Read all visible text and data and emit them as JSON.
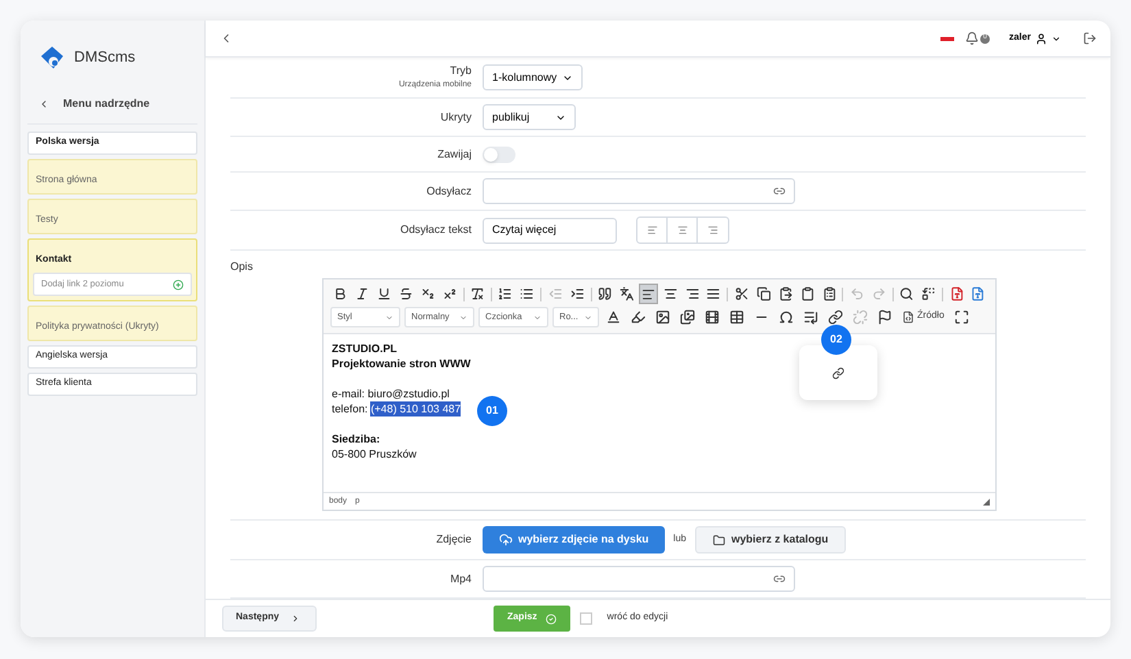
{
  "brand": {
    "name": "DMScms"
  },
  "sidebar": {
    "back_label": "Menu nadrzędne",
    "items": [
      {
        "label": "Polska wersja",
        "kind": "section"
      },
      {
        "label": "Strona główna",
        "kind": "page",
        "expanded": false
      },
      {
        "label": "Testy",
        "kind": "page",
        "expanded": false
      },
      {
        "label": "Kontakt",
        "kind": "page",
        "expanded": true,
        "add_placeholder": "Dodaj link 2 poziomu"
      },
      {
        "label": "Polityka prywatności (Ukryty)",
        "kind": "page",
        "expanded": false
      },
      {
        "label": "Angielska wersja",
        "kind": "section"
      },
      {
        "label": "Strefa klienta",
        "kind": "section"
      }
    ]
  },
  "header": {
    "notifications": "0",
    "user": "zaler"
  },
  "form_top": [
    {
      "label": "Tryb",
      "sublabel": "Urządzenia mobilne",
      "kind": "select",
      "value": "1-kolumnowy"
    },
    {
      "label": "Ukryty",
      "kind": "select",
      "value": "publikuj"
    },
    {
      "label": "Zawijaj",
      "kind": "toggle",
      "on": false
    },
    {
      "label": "Odsyłacz",
      "kind": "link_input"
    },
    {
      "label": "Odsyłacz tekst",
      "kind": "text_align",
      "value": "Czytaj więcej"
    }
  ],
  "editor": {
    "label": "Opis",
    "dropdowns": [
      "Styl",
      "Normalny",
      "Czcionka",
      "Ro..."
    ],
    "source_label": "Źródło",
    "align_left_active": true,
    "content": [
      {
        "kind": "bold",
        "text": "ZSTUDIO.PL"
      },
      {
        "kind": "bold",
        "text": "Projektowanie stron WWW"
      },
      {
        "kind": "blank"
      },
      {
        "kind": "text",
        "text": "e-mail: biuro@zstudio.pl"
      },
      {
        "kind": "highlight",
        "text": "telefon: ",
        "highlight": "(+48) 510 103 487"
      },
      {
        "kind": "blank"
      },
      {
        "kind": "bold",
        "text": "Siedziba:"
      },
      {
        "kind": "text",
        "text": "05-800 Pruszków"
      }
    ],
    "path": [
      "body",
      "p"
    ]
  },
  "callouts": [
    {
      "text": "01"
    },
    {
      "text": "02"
    }
  ],
  "form_bottom": [
    {
      "label": "Zdjęcie",
      "kind": "upload",
      "primary": "wybierz zdjęcie na dysku",
      "separator": "lub",
      "secondary": "wybierz z katalogu"
    },
    {
      "label": "Mp4",
      "kind": "link_input"
    }
  ],
  "footer": {
    "next": "Następny",
    "save": "Zapisz",
    "return_label": "wróć do edycji",
    "return_checked": false
  }
}
